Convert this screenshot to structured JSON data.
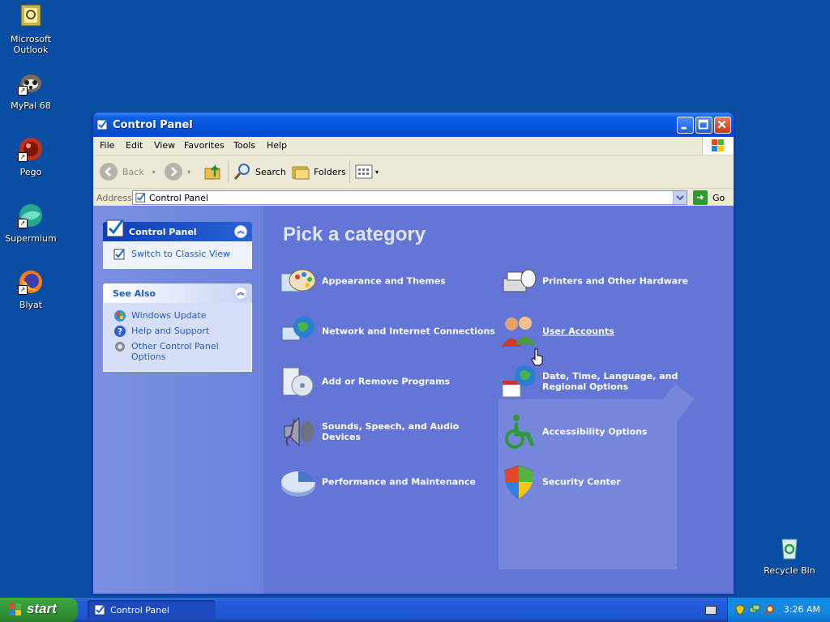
{
  "desktop": {
    "icons": [
      {
        "label": "Microsoft Outlook",
        "icon": "outlook-icon"
      },
      {
        "label": "MyPal 68",
        "icon": "mypal-icon"
      },
      {
        "label": "Pego",
        "icon": "pego-icon"
      },
      {
        "label": "Supermium",
        "icon": "supermium-icon"
      },
      {
        "label": "Blyat",
        "icon": "firefox-icon"
      },
      {
        "label": "Recycle Bin",
        "icon": "recycle-bin-icon"
      }
    ]
  },
  "window": {
    "title": "Control Panel",
    "menu": [
      "File",
      "Edit",
      "View",
      "Favorites",
      "Tools",
      "Help"
    ],
    "toolbar": {
      "back": "Back",
      "search": "Search",
      "folders": "Folders"
    },
    "address": {
      "label": "Address",
      "value": "Control Panel",
      "go": "Go"
    },
    "left_pane": {
      "panel1": {
        "title": "Control Panel",
        "items": [
          "Switch to Classic View"
        ]
      },
      "panel2": {
        "title": "See Also",
        "items": [
          "Windows Update",
          "Help and Support",
          "Other Control Panel Options"
        ]
      }
    },
    "main": {
      "heading": "Pick a category",
      "categories": [
        "Appearance and Themes",
        "Printers and Other Hardware",
        "Network and Internet Connections",
        "User Accounts",
        "Add or Remove Programs",
        "Date, Time, Language, and Regional Options",
        "Sounds, Speech, and Audio Devices",
        "Accessibility Options",
        "Performance and Maintenance",
        "Security Center"
      ]
    }
  },
  "taskbar": {
    "start": "start",
    "task": "Control Panel",
    "clock": "3:26 AM"
  },
  "colors": {
    "desktop": "#0a4ea3",
    "content_bg": "#6375d6",
    "link": "#215dc6"
  }
}
